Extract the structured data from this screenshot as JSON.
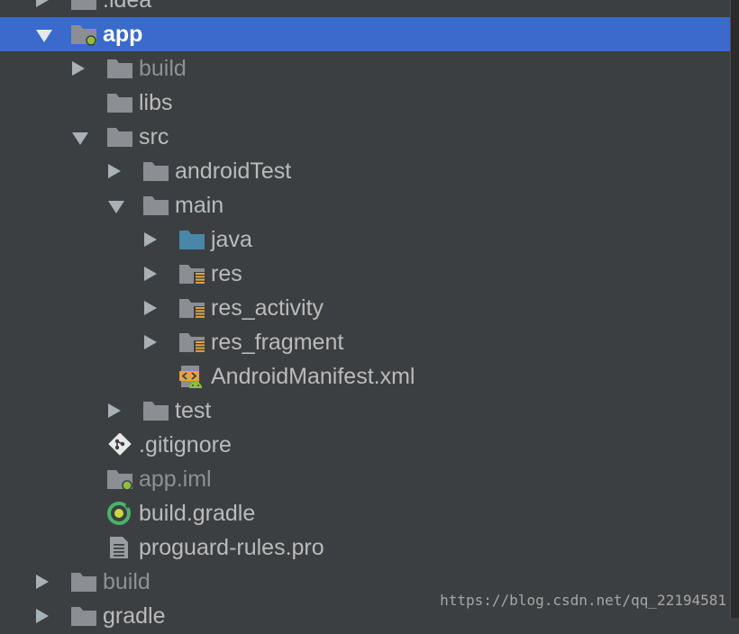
{
  "tree": {
    "items": [
      {
        "label": ".idea",
        "depth": 1,
        "arrow": "right",
        "icon": "folder-icon",
        "dim": false,
        "selected": false
      },
      {
        "label": "app",
        "depth": 1,
        "arrow": "down",
        "icon": "module-folder-icon",
        "dim": false,
        "selected": true
      },
      {
        "label": "build",
        "depth": 2,
        "arrow": "right",
        "icon": "folder-icon",
        "dim": true,
        "selected": false
      },
      {
        "label": "libs",
        "depth": 2,
        "arrow": "none",
        "icon": "folder-icon",
        "dim": false,
        "selected": false
      },
      {
        "label": "src",
        "depth": 2,
        "arrow": "down",
        "icon": "folder-icon",
        "dim": false,
        "selected": false
      },
      {
        "label": "androidTest",
        "depth": 3,
        "arrow": "right",
        "icon": "folder-icon",
        "dim": false,
        "selected": false
      },
      {
        "label": "main",
        "depth": 3,
        "arrow": "down",
        "icon": "folder-icon",
        "dim": false,
        "selected": false
      },
      {
        "label": "java",
        "depth": 4,
        "arrow": "right",
        "icon": "source-folder-icon",
        "dim": false,
        "selected": false
      },
      {
        "label": "res",
        "depth": 4,
        "arrow": "right",
        "icon": "resource-folder-icon",
        "dim": false,
        "selected": false
      },
      {
        "label": "res_activity",
        "depth": 4,
        "arrow": "right",
        "icon": "resource-folder-icon",
        "dim": false,
        "selected": false
      },
      {
        "label": "res_fragment",
        "depth": 4,
        "arrow": "right",
        "icon": "resource-folder-icon",
        "dim": false,
        "selected": false
      },
      {
        "label": "AndroidManifest.xml",
        "depth": 4,
        "arrow": "none",
        "icon": "android-manifest-icon",
        "dim": false,
        "selected": false
      },
      {
        "label": "test",
        "depth": 3,
        "arrow": "right",
        "icon": "folder-icon",
        "dim": false,
        "selected": false
      },
      {
        "label": ".gitignore",
        "depth": 2,
        "arrow": "none",
        "icon": "git-icon",
        "dim": false,
        "selected": false
      },
      {
        "label": "app.iml",
        "depth": 2,
        "arrow": "none",
        "icon": "module-file-icon",
        "dim": true,
        "selected": false
      },
      {
        "label": "build.gradle",
        "depth": 2,
        "arrow": "none",
        "icon": "gradle-icon",
        "dim": false,
        "selected": false
      },
      {
        "label": "proguard-rules.pro",
        "depth": 2,
        "arrow": "none",
        "icon": "text-file-icon",
        "dim": false,
        "selected": false
      },
      {
        "label": "build",
        "depth": 1,
        "arrow": "right",
        "icon": "folder-icon",
        "dim": true,
        "selected": false
      },
      {
        "label": "gradle",
        "depth": 1,
        "arrow": "right",
        "icon": "folder-icon",
        "dim": false,
        "selected": false
      }
    ]
  },
  "watermark": "https://blog.csdn.net/qq_22194581",
  "colors": {
    "background": "#3c3f41",
    "selection": "#3a6acb",
    "folder": "#8b8f94",
    "source_folder": "#4a86a8",
    "module_dot": "#8fbf3a",
    "resource_bars": "#e0a53a"
  }
}
